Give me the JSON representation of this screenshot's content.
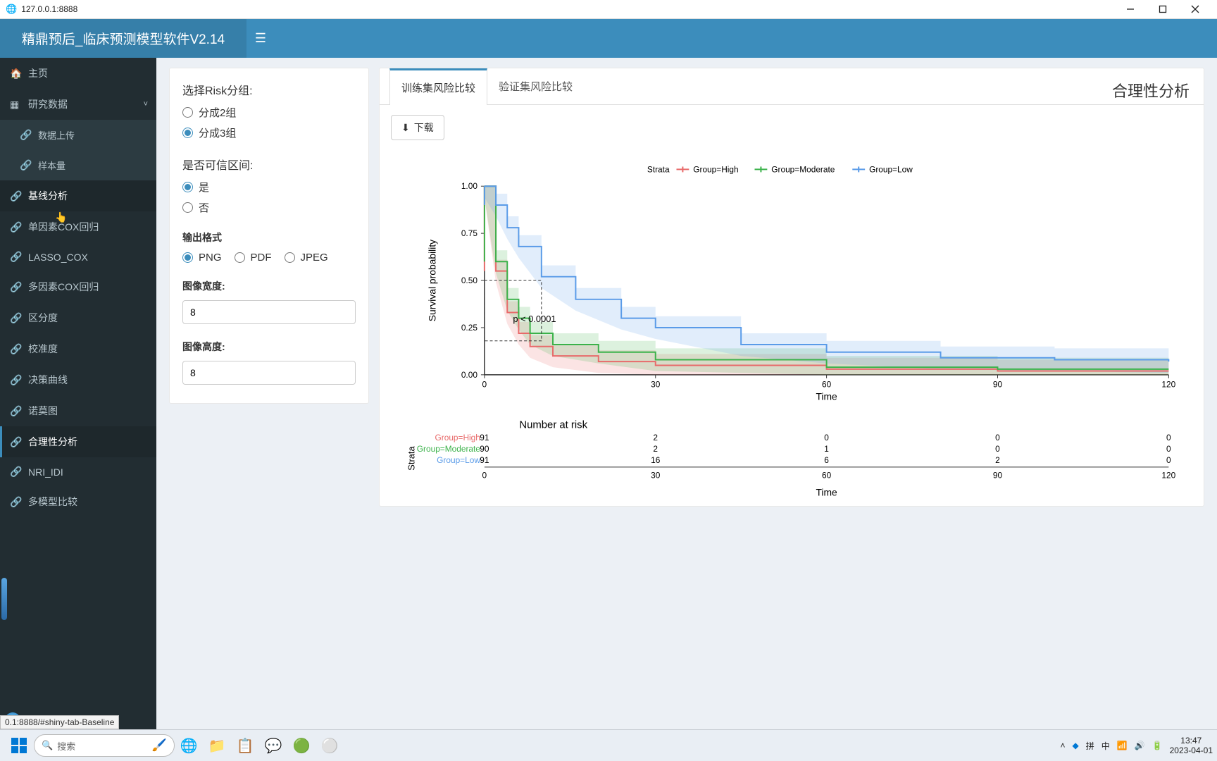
{
  "window": {
    "url": "127.0.0.1:8888"
  },
  "header": {
    "brand": "精鼎预后_临床预测模型软件V2.14"
  },
  "sidebar": {
    "home": "主页",
    "research": "研究数据",
    "sub": {
      "upload": "数据上传",
      "sample": "样本量"
    },
    "items": [
      "基线分析",
      "单因素COX回归",
      "LASSO_COX",
      "多因素COX回归",
      "区分度",
      "校准度",
      "决策曲线",
      "诺莫图",
      "合理性分析",
      "NRI_IDI",
      "多模型比较"
    ]
  },
  "form": {
    "riskGroup": {
      "label": "选择Risk分组:",
      "g2": "分成2组",
      "g3": "分成3组"
    },
    "ci": {
      "label": "是否可信区间:",
      "yes": "是",
      "no": "否"
    },
    "fmt": {
      "label": "输出格式",
      "png": "PNG",
      "pdf": "PDF",
      "jpeg": "JPEG"
    },
    "width": {
      "label": "图像宽度:",
      "value": "8"
    },
    "height": {
      "label": "图像高度:",
      "value": "8"
    }
  },
  "tabs": {
    "train": "训练集风险比较",
    "valid": "验证集风险比较",
    "title": "合理性分析"
  },
  "download": "下载",
  "chart_data": {
    "type": "line",
    "title": "",
    "xlabel": "Time",
    "ylabel": "Survival probability",
    "xlim": [
      0,
      120
    ],
    "ylim": [
      0,
      1.0
    ],
    "xticks": [
      0,
      30,
      60,
      90,
      120
    ],
    "yticks": [
      0.0,
      0.25,
      0.5,
      0.75,
      1.0
    ],
    "legend_title": "Strata",
    "annotation": "p < 0.0001",
    "series": [
      {
        "name": "Group=High",
        "color": "#e86a6a",
        "x": [
          0,
          2,
          4,
          6,
          8,
          12,
          20,
          30,
          60,
          90,
          120
        ],
        "y": [
          1.0,
          0.55,
          0.33,
          0.22,
          0.15,
          0.1,
          0.07,
          0.05,
          0.03,
          0.02,
          0.02
        ]
      },
      {
        "name": "Group=Moderate",
        "color": "#3bb24a",
        "x": [
          0,
          2,
          4,
          6,
          8,
          12,
          20,
          30,
          60,
          90,
          120
        ],
        "y": [
          1.0,
          0.6,
          0.4,
          0.3,
          0.22,
          0.16,
          0.12,
          0.08,
          0.04,
          0.03,
          0.03
        ]
      },
      {
        "name": "Group=Low",
        "color": "#5a9be8",
        "x": [
          0,
          2,
          4,
          6,
          10,
          16,
          24,
          30,
          45,
          60,
          80,
          100,
          120
        ],
        "y": [
          1.0,
          0.9,
          0.78,
          0.68,
          0.52,
          0.4,
          0.3,
          0.25,
          0.16,
          0.12,
          0.09,
          0.08,
          0.07
        ]
      }
    ],
    "risk_table": {
      "title": "Number at risk",
      "ylabel": "Strata",
      "xlabel": "Time",
      "times": [
        0,
        30,
        60,
        90,
        120
      ],
      "rows": [
        {
          "name": "Group=High",
          "color": "#e86a6a",
          "n": [
            91,
            2,
            0,
            0,
            0
          ]
        },
        {
          "name": "Group=Moderate",
          "color": "#3bb24a",
          "n": [
            90,
            2,
            1,
            0,
            0
          ]
        },
        {
          "name": "Group=Low",
          "color": "#5a9be8",
          "n": [
            91,
            16,
            6,
            2,
            0
          ]
        }
      ]
    }
  },
  "status": "0.1:8888/#shiny-tab-Baseline",
  "taskbar": {
    "search": "搜索",
    "ime": "中",
    "clock": {
      "time": "13:47",
      "date": "2023-04-01"
    }
  }
}
